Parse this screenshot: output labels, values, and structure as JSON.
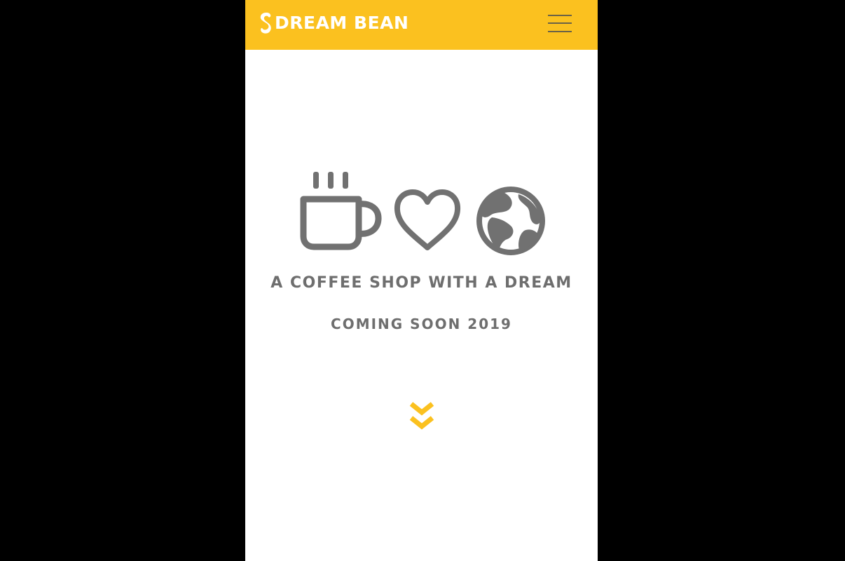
{
  "header": {
    "brand": "DREAM BEAN",
    "brand_color": "#fbc11f",
    "menu_icon": "hamburger-menu-icon"
  },
  "hero": {
    "icons": [
      "coffee-cup-icon",
      "heart-icon",
      "globe-icon"
    ],
    "icon_color": "#717171",
    "tagline": "A COFFEE SHOP WITH A DREAM",
    "status": "COMING SOON 2019",
    "scroll_icon": "double-chevron-down-icon",
    "accent_color": "#fbc11f"
  }
}
